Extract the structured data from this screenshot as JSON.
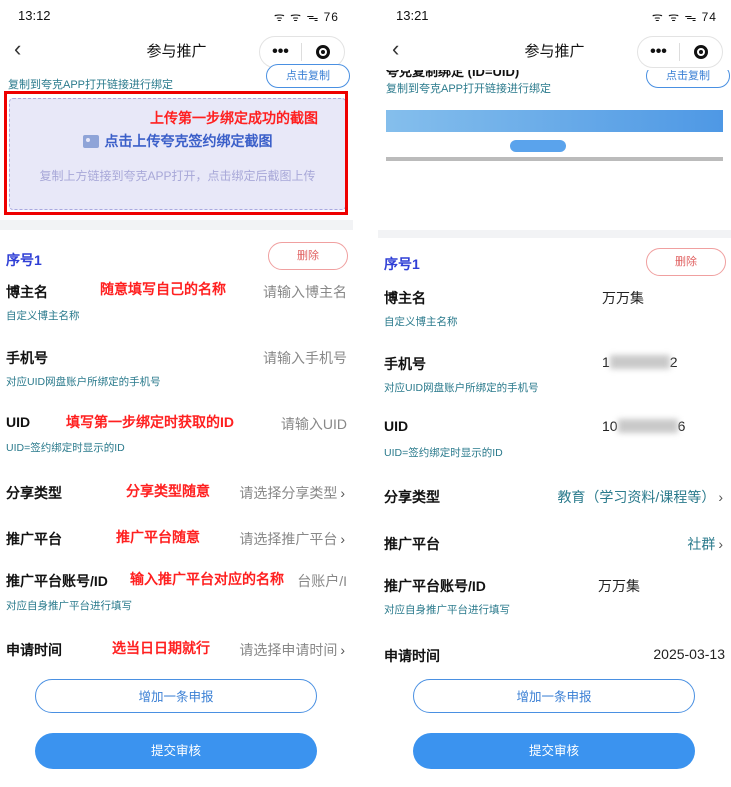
{
  "left": {
    "status": {
      "time": "13:12",
      "icons": "ᯤ ᯤ ᯓ 76"
    },
    "nav": {
      "back": "‹",
      "title": "参与推广",
      "more": "•••"
    },
    "copy_tip": "复制到夸克APP打开链接进行绑定",
    "copy_button": "点击复制",
    "upload": {
      "title": "点击上传夸克签约绑定截图",
      "tip": "复制上方链接到夸克APP打开，点击绑定后截图上传"
    },
    "annotations": {
      "upload": "上传第一步绑定成功的截图",
      "blogger": "随意填写自己的名称",
      "uid": "填写第一步绑定时获取的ID",
      "share_type": "分享类型随意",
      "platform": "推广平台随意",
      "account": "输入推广平台对应的名称",
      "date": "选当日日期就行"
    },
    "seq": "序号1",
    "delete": "删除",
    "fields": {
      "blogger": {
        "label": "博主名",
        "hint": "自定义博主名称",
        "value": "请输入博主名"
      },
      "phone": {
        "label": "手机号",
        "hint": "对应UID网盘账户所绑定的手机号",
        "value": "请输入手机号"
      },
      "uid": {
        "label": "UID",
        "hint": "UID=签约绑定时显示的ID",
        "value": "请输入UID"
      },
      "share_type": {
        "label": "分享类型",
        "value": "请选择分享类型"
      },
      "platform": {
        "label": "推广平台",
        "value": "请选择推广平台"
      },
      "account": {
        "label": "推广平台账号/ID",
        "hint": "对应自身推广平台进行填写",
        "value": "台账户/I"
      },
      "date": {
        "label": "申请时间",
        "value": "请选择申请时间"
      }
    },
    "add_button": "增加一条申报",
    "submit_button": "提交审核"
  },
  "right": {
    "status": {
      "time": "13:21",
      "icons": "ᯤ ᯤ ᯓ 74"
    },
    "nav": {
      "back": "‹",
      "title": "参与推广",
      "more": "•••"
    },
    "cut_heading": "夸克复制绑定 (ID=UID)",
    "copy_tip": "复制到夸克APP打开链接进行绑定",
    "copy_button": "点击复制",
    "seq": "序号1",
    "delete": "删除",
    "fields": {
      "blogger": {
        "label": "博主名",
        "hint": "自定义博主名称",
        "value": "万万集"
      },
      "phone": {
        "label": "手机号",
        "hint": "对应UID网盘账户所绑定的手机号",
        "value_start": "1",
        "value_end": "2"
      },
      "uid": {
        "label": "UID",
        "hint": "UID=签约绑定时显示的ID",
        "value_start": "10",
        "value_end": "6"
      },
      "share_type": {
        "label": "分享类型",
        "value": "教育（学习资料/课程等）"
      },
      "platform": {
        "label": "推广平台",
        "value": "社群"
      },
      "account": {
        "label": "推广平台账号/ID",
        "hint": "对应自身推广平台进行填写",
        "value": "万万集"
      },
      "date": {
        "label": "申请时间",
        "value": "2025-03-13"
      }
    },
    "add_button": "增加一条申报",
    "submit_button": "提交审核"
  },
  "colors": {
    "accent": "#3b93ef",
    "annotation": "#ff2020",
    "seq": "#2f3fd6",
    "hint": "#2a7a8c"
  }
}
